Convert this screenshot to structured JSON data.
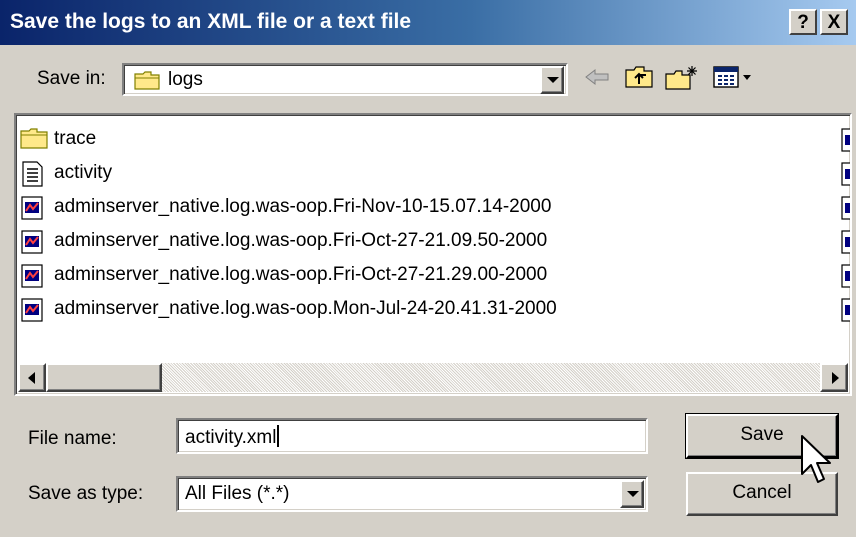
{
  "window": {
    "title": "Save the logs to an XML file or a text file",
    "help_label": "?",
    "close_label": "X"
  },
  "save_in": {
    "label": "Save in:",
    "value": "logs"
  },
  "toolbar": {
    "icons": [
      "back-arrow-icon",
      "up-one-level-icon",
      "create-new-folder-icon",
      "view-menu-icon"
    ]
  },
  "files": [
    {
      "name": "trace",
      "icon": "folder-icon"
    },
    {
      "name": "activity",
      "icon": "text-file-icon"
    },
    {
      "name": "adminserver_native.log.was-oop.Fri-Nov-10-15.07.14-2000",
      "icon": "log-file-icon"
    },
    {
      "name": "adminserver_native.log.was-oop.Fri-Oct-27-21.09.50-2000",
      "icon": "log-file-icon"
    },
    {
      "name": "adminserver_native.log.was-oop.Fri-Oct-27-21.29.00-2000",
      "icon": "log-file-icon"
    },
    {
      "name": "adminserver_native.log.was-oop.Mon-Jul-24-20.41.31-2000",
      "icon": "log-file-icon"
    }
  ],
  "file_name": {
    "label": "File name:",
    "value": "activity.xml"
  },
  "save_as_type": {
    "label": "Save as type:",
    "value": "All Files (*.*)"
  },
  "buttons": {
    "save": "Save",
    "cancel": "Cancel"
  }
}
